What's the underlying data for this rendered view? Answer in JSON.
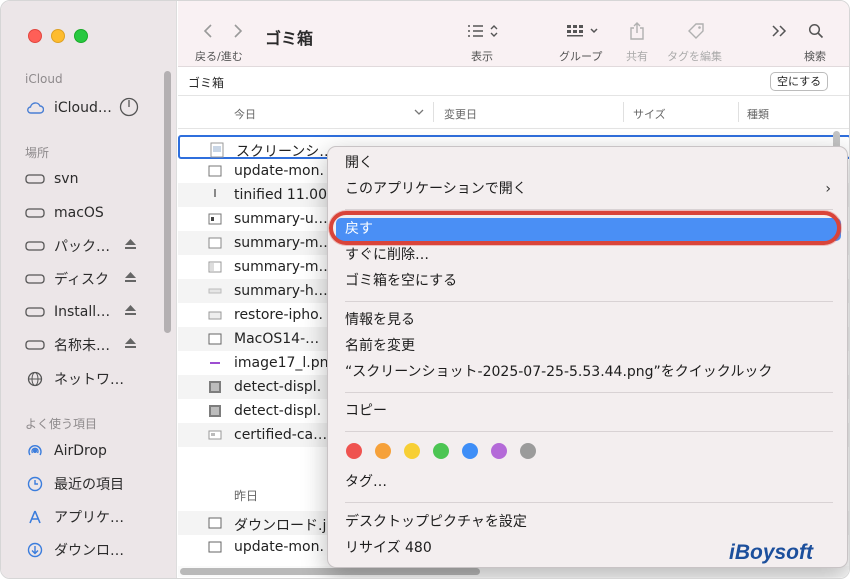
{
  "window": {
    "title": "ゴミ箱"
  },
  "toolbar": {
    "nav_label": "戻る/進む",
    "view_label": "表示",
    "group_label": "グループ",
    "share_label": "共有",
    "tag_edit_label": "タグを編集",
    "search_label": "検索"
  },
  "pathbar": {
    "path": "ゴミ箱",
    "empty_button": "空にする"
  },
  "sidebar": {
    "icloud_header": "iCloud",
    "icloud_item": "iCloud…",
    "locations_header": "場所",
    "locations": [
      "svn",
      "macOS",
      "パック…",
      "ディスク",
      "Install…",
      "名称未…",
      "ネットワ…"
    ],
    "favorites_header": "よく使う項目",
    "favorites": [
      "AirDrop",
      "最近の項目",
      "アプリケ…",
      "ダウンロ…"
    ]
  },
  "columns": {
    "name": "今日",
    "modified": "変更日",
    "size": "サイズ",
    "kind": "種類"
  },
  "files_today": [
    "スクリーンシ…",
    "update-mon.",
    "tinified 11.00.",
    "summary-u…",
    "summary-m…",
    "summary-m…",
    "summary-h…",
    "restore-ipho.",
    "MacOS14-…",
    "image17_l.pn",
    "detect-displ.",
    "detect-displ.",
    "certified-ca…"
  ],
  "group_yesterday": "昨日",
  "files_yesterday": [
    "ダウンロード.j",
    "update-mon."
  ],
  "context_menu": {
    "open": "開く",
    "open_with": "このアプリケーションで開く",
    "put_back": "戻す",
    "delete_now": "すぐに削除…",
    "empty_trash": "ゴミ箱を空にする",
    "get_info": "情報を見る",
    "rename": "名前を変更",
    "quick_look": "“スクリーンショット-2025-07-25-5.53.44.png”をクイックルック",
    "copy": "コピー",
    "tags": "タグ…",
    "set_desktop": "デスクトップピクチャを設定",
    "resize": "リサイズ 480",
    "tag_colors": [
      "#ef5350",
      "#f6a13a",
      "#f7cf35",
      "#4cc553",
      "#3e8ef7",
      "#b46ad8",
      "#9b9b9b"
    ]
  },
  "watermark": "iBoysoft"
}
